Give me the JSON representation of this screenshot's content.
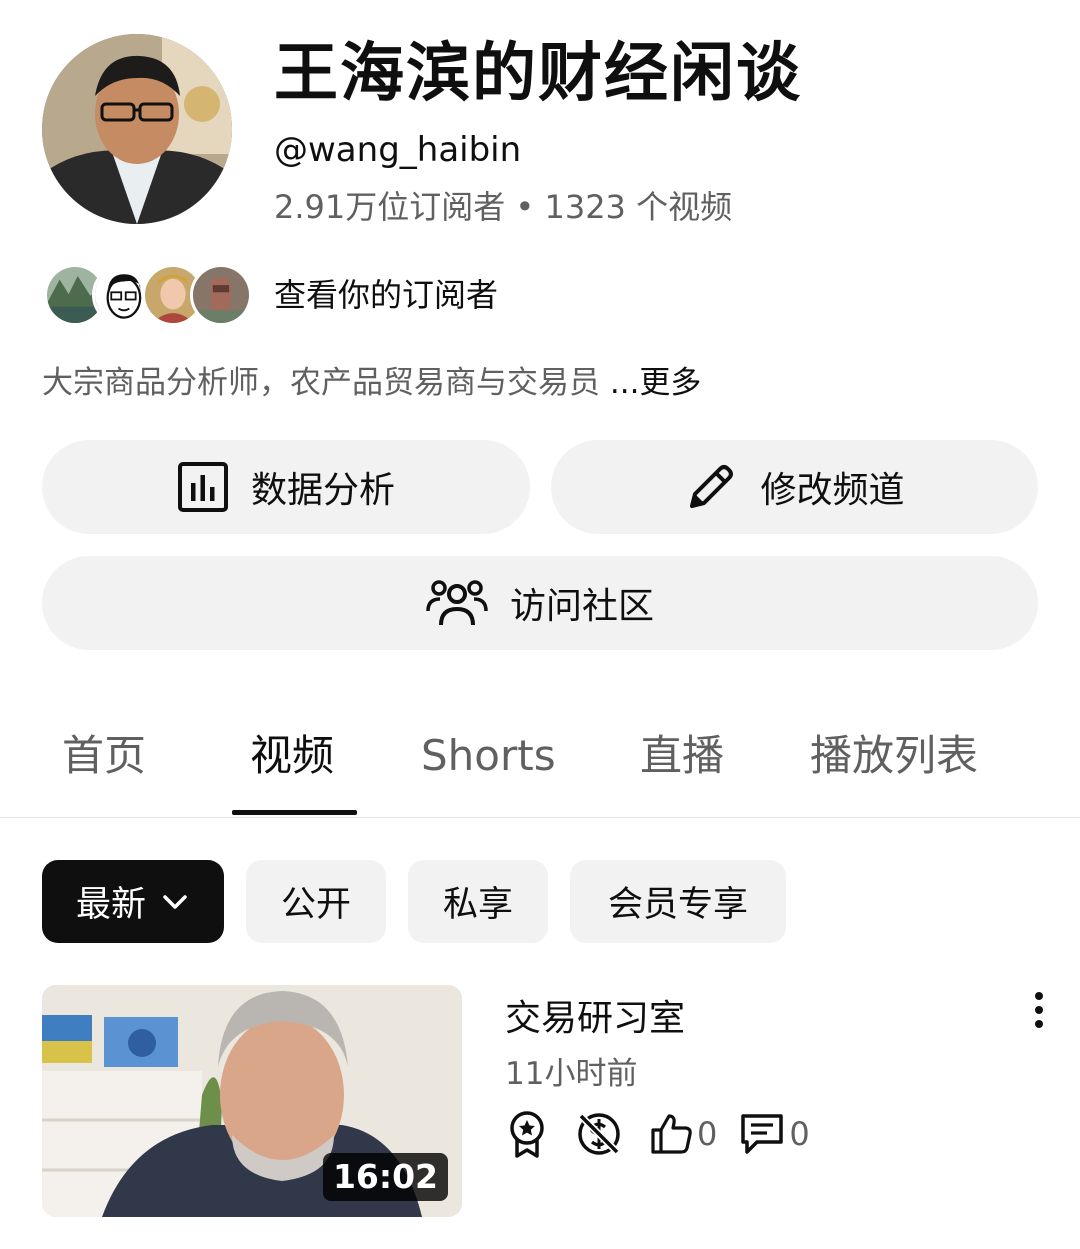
{
  "channel": {
    "name": "王海滨的财经闲谈",
    "handle": "@wang_haibin",
    "stats": "2.91万位订阅者 • 1323 个视频",
    "view_subscribers": "查看你的订阅者",
    "description": "大宗商品分析师，农产品贸易商与交易员 ",
    "description_more": "...更多"
  },
  "actions": {
    "analytics": "数据分析",
    "edit_channel": "修改频道",
    "visit_community": "访问社区"
  },
  "tabs": [
    {
      "label": "首页",
      "active": false
    },
    {
      "label": "视频",
      "active": true
    },
    {
      "label": "Shorts",
      "active": false
    },
    {
      "label": "直播",
      "active": false
    },
    {
      "label": "播放列表",
      "active": false
    }
  ],
  "filters": {
    "sort": "最新",
    "chips": [
      "公开",
      "私享",
      "会员专享"
    ]
  },
  "videos": [
    {
      "title": "交易研习室",
      "age": "11小时前",
      "duration": "16:02",
      "likes": "0",
      "comments": "0"
    }
  ],
  "icons": {
    "analytics": "bar-chart-icon",
    "edit": "pencil-icon",
    "community": "people-icon",
    "sort": "chevron-down-icon",
    "more": "kebab-menu-icon",
    "members": "badge-star-icon",
    "monetization": "dollar-off-icon",
    "like": "thumbs-up-icon",
    "comment": "comment-icon"
  },
  "colors": {
    "text_primary": "#0f0f0f",
    "text_secondary": "#606060",
    "chip_background": "#f2f2f2",
    "active_chip": "#0f0f0f"
  }
}
